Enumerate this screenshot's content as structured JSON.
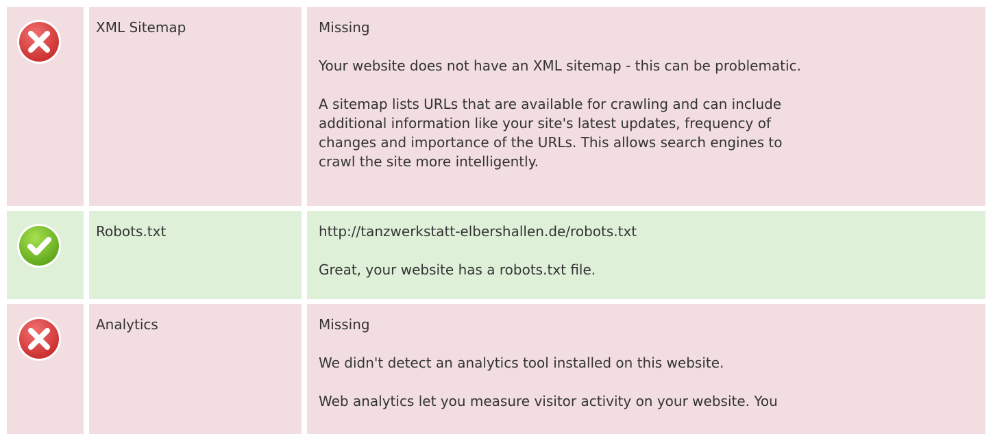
{
  "colors": {
    "error_row_bg": "#f2dde0",
    "success_row_bg": "#dff0d8",
    "error_icon": "#e43c3c",
    "success_icon": "#76c322"
  },
  "rows": [
    {
      "status": "error",
      "icon": "error-x-icon",
      "name": "XML Sitemap",
      "paragraphs": [
        "Missing",
        "Your website does not have an XML sitemap - this can be problematic.",
        "A sitemap lists URLs that are available for crawling and can include\nadditional information like your site's latest updates, frequency of\nchanges and importance of the URLs. This allows search engines to\ncrawl the site more intelligently."
      ]
    },
    {
      "status": "success",
      "icon": "success-check-icon",
      "name": "Robots.txt",
      "paragraphs": [
        "http://tanzwerkstatt-elbershallen.de/robots.txt",
        "Great, your website has a robots.txt file."
      ]
    },
    {
      "status": "error",
      "icon": "error-x-icon",
      "name": "Analytics",
      "paragraphs": [
        "Missing",
        "We didn't detect an analytics tool installed on this website.",
        "Web analytics let you measure visitor activity on your website. You"
      ]
    }
  ]
}
